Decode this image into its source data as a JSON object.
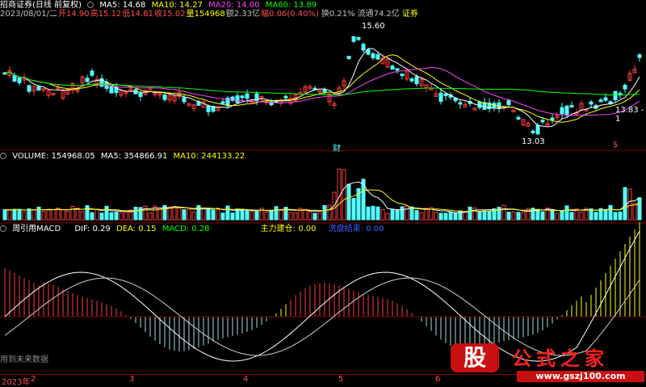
{
  "header": {
    "title": "招商证券(日线 前复权)",
    "ma5_label": "MA5: 14.68",
    "ma10_label": "MA10: 14.27",
    "ma20_label": "MA20: 14.00",
    "ma60_label": "MA60: 13.89"
  },
  "quote": {
    "date": "2023/08/01/二",
    "open": "开14.90",
    "high": "高15.12",
    "low": "低14.81",
    "close": "收15.02",
    "volume": "量154968",
    "amount": "额2.33亿",
    "change": "幅0.06(0.40%)",
    "turnover": "换0.21%",
    "float": "流通74.2亿",
    "sector": "证券"
  },
  "price_annotations": {
    "high_mark": "15.60",
    "low_mark": "13.03",
    "right_mark": "13.83 - 1",
    "event_cai": "财",
    "event_s": "$"
  },
  "volume_header": {
    "volume": "VOLUME: 154968.05",
    "ma5": "MA5: 354866.91",
    "ma10": "MA10: 244133.22"
  },
  "macd_header": {
    "name": "周引用MACD",
    "dif": "DIF: 0.29",
    "dea": "DEA: 0.15",
    "macd": "MACD: 0.28",
    "main_build": "主力建仓: 0.00",
    "main_out": "洗盘结束: 0.00"
  },
  "macd_footer": "用到未来数据",
  "axis": {
    "year": "2023年",
    "months": [
      "2",
      "3",
      "4",
      "5",
      "6"
    ]
  },
  "colors": {
    "up": "#ff3c3c",
    "down": "#54ffff",
    "ma5": "#ffffff",
    "ma10": "#ffff00",
    "ma20": "#ff44ff",
    "ma60": "#00ff00",
    "macd_pos": "#ff3c3c",
    "macd_pos_strong": "#ffff00",
    "macd_neg": "#54ffff",
    "macd_neg_light": "#9fe0e0"
  },
  "watermark": {
    "logo": "股",
    "text": "公式之家",
    "url": "www.gszj100.com"
  }
}
